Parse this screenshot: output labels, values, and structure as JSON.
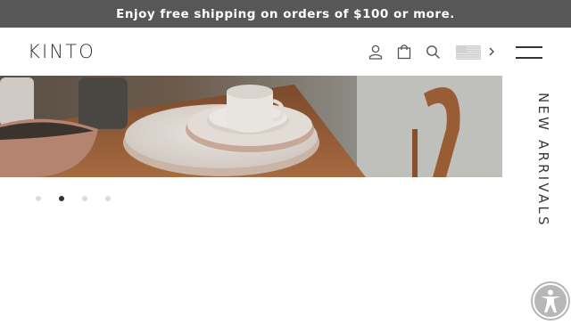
{
  "announcement": {
    "text": "Enjoy free shipping on orders of $100 or more."
  },
  "header": {
    "logo": "KINTO",
    "icons": [
      "user-icon",
      "shopping-bag-icon",
      "search-icon",
      "us-flag-icon",
      "chevron-right-icon",
      "menu-icon"
    ]
  },
  "hero": {
    "slide_count": 4,
    "active_slide": 2
  },
  "side_tab": {
    "label": "NEW ARRIVALS"
  },
  "accessibility": {
    "icon": "accessibility-icon"
  },
  "colors": {
    "announcement_bg": "#575757",
    "dot_active": "#333333",
    "dot_inactive": "#dcdcdc",
    "accessibility_bg": "#b7b7b7"
  }
}
